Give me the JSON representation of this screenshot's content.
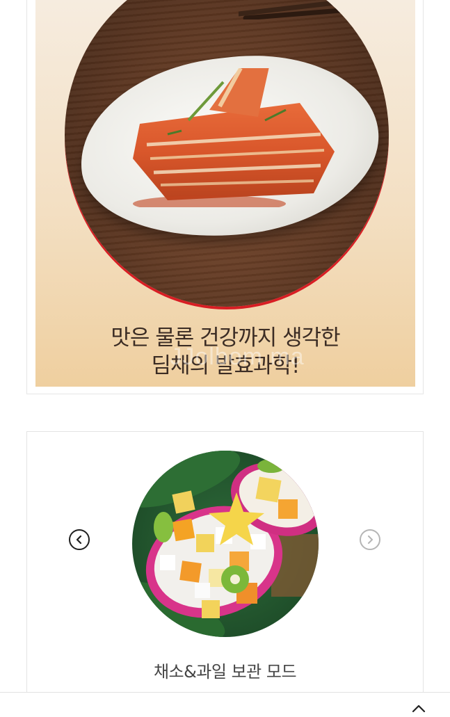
{
  "banner": {
    "line1": "맛은 물론 건강까지 생각한",
    "line2": "딤채의 발효과학!",
    "watermark": "JJolbom ma"
  },
  "slider": {
    "mode_label": "채소&과일 보관 모드",
    "prev_icon": "chevron-left-circle-icon",
    "next_icon": "chevron-right-circle-icon"
  },
  "footer": {
    "icon": "scroll-top-icon"
  },
  "colors": {
    "accent_red": "#d81e24",
    "banner_bg": "#f3dfc2",
    "text_dark": "#3b2c24"
  }
}
